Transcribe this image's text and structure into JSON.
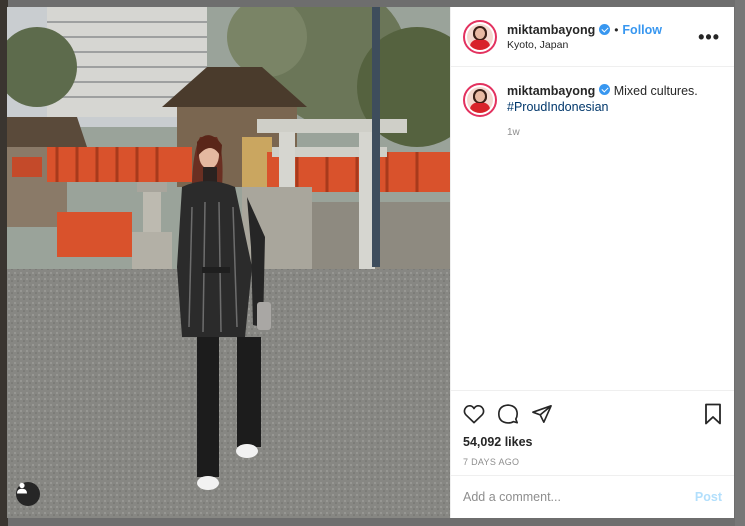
{
  "post": {
    "username": "miktambayong",
    "verified": true,
    "follow_label": "Follow",
    "separator": "•",
    "location": "Kyoto, Japan",
    "more_label": "•••"
  },
  "caption": {
    "username": "miktambayong",
    "text": "Mixed cultures.",
    "hashtag": "#ProudIndonesian",
    "time_ago": "1w"
  },
  "actions": {
    "icons": [
      "heart-icon",
      "comment-icon",
      "share-icon",
      "bookmark-icon"
    ],
    "likes": "54,092 likes",
    "posted": "7 DAYS AGO"
  },
  "comment_box": {
    "placeholder": "Add a comment...",
    "post_label": "Post"
  },
  "colors": {
    "accent_blue": "#3897f0",
    "post_disabled": "#b2dffc",
    "torii_red": "#d9522c"
  }
}
